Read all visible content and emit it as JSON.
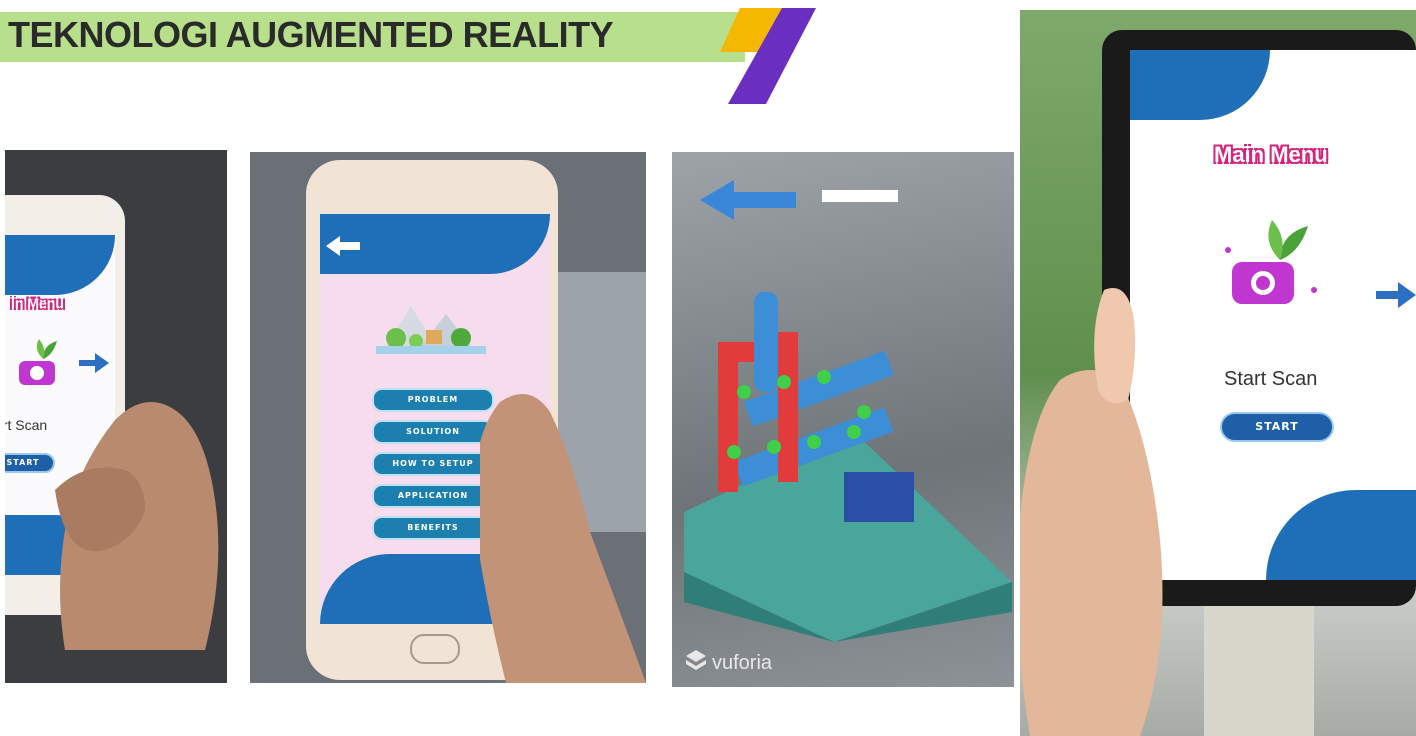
{
  "title": "TEKNOLOGI AUGMENTED REALITY",
  "colors": {
    "title_band": "#b8e08c",
    "accent_yellow": "#f5b800",
    "accent_purple": "#6a2fc0",
    "menu_title_outline": "#d6237e",
    "button_blue": "#1e5fa8"
  },
  "photo1": {
    "menu_title": "in Menu",
    "start_scan": "art Scan",
    "start_label": "START"
  },
  "photo2": {
    "menu_buttons": [
      "PROBLEM",
      "SOLUTION",
      "HOW TO SETUP",
      "APPLICATION",
      "BENEFITS"
    ]
  },
  "photo3": {
    "vuforia": "vuforia"
  },
  "photo4": {
    "menu_title": "Main Menu",
    "start_scan": "Start Scan",
    "start_label": "START"
  },
  "icons": [
    "camera-plant-icon",
    "arrow-right-icon",
    "back-arrow-icon",
    "vuforia-logo-icon"
  ]
}
